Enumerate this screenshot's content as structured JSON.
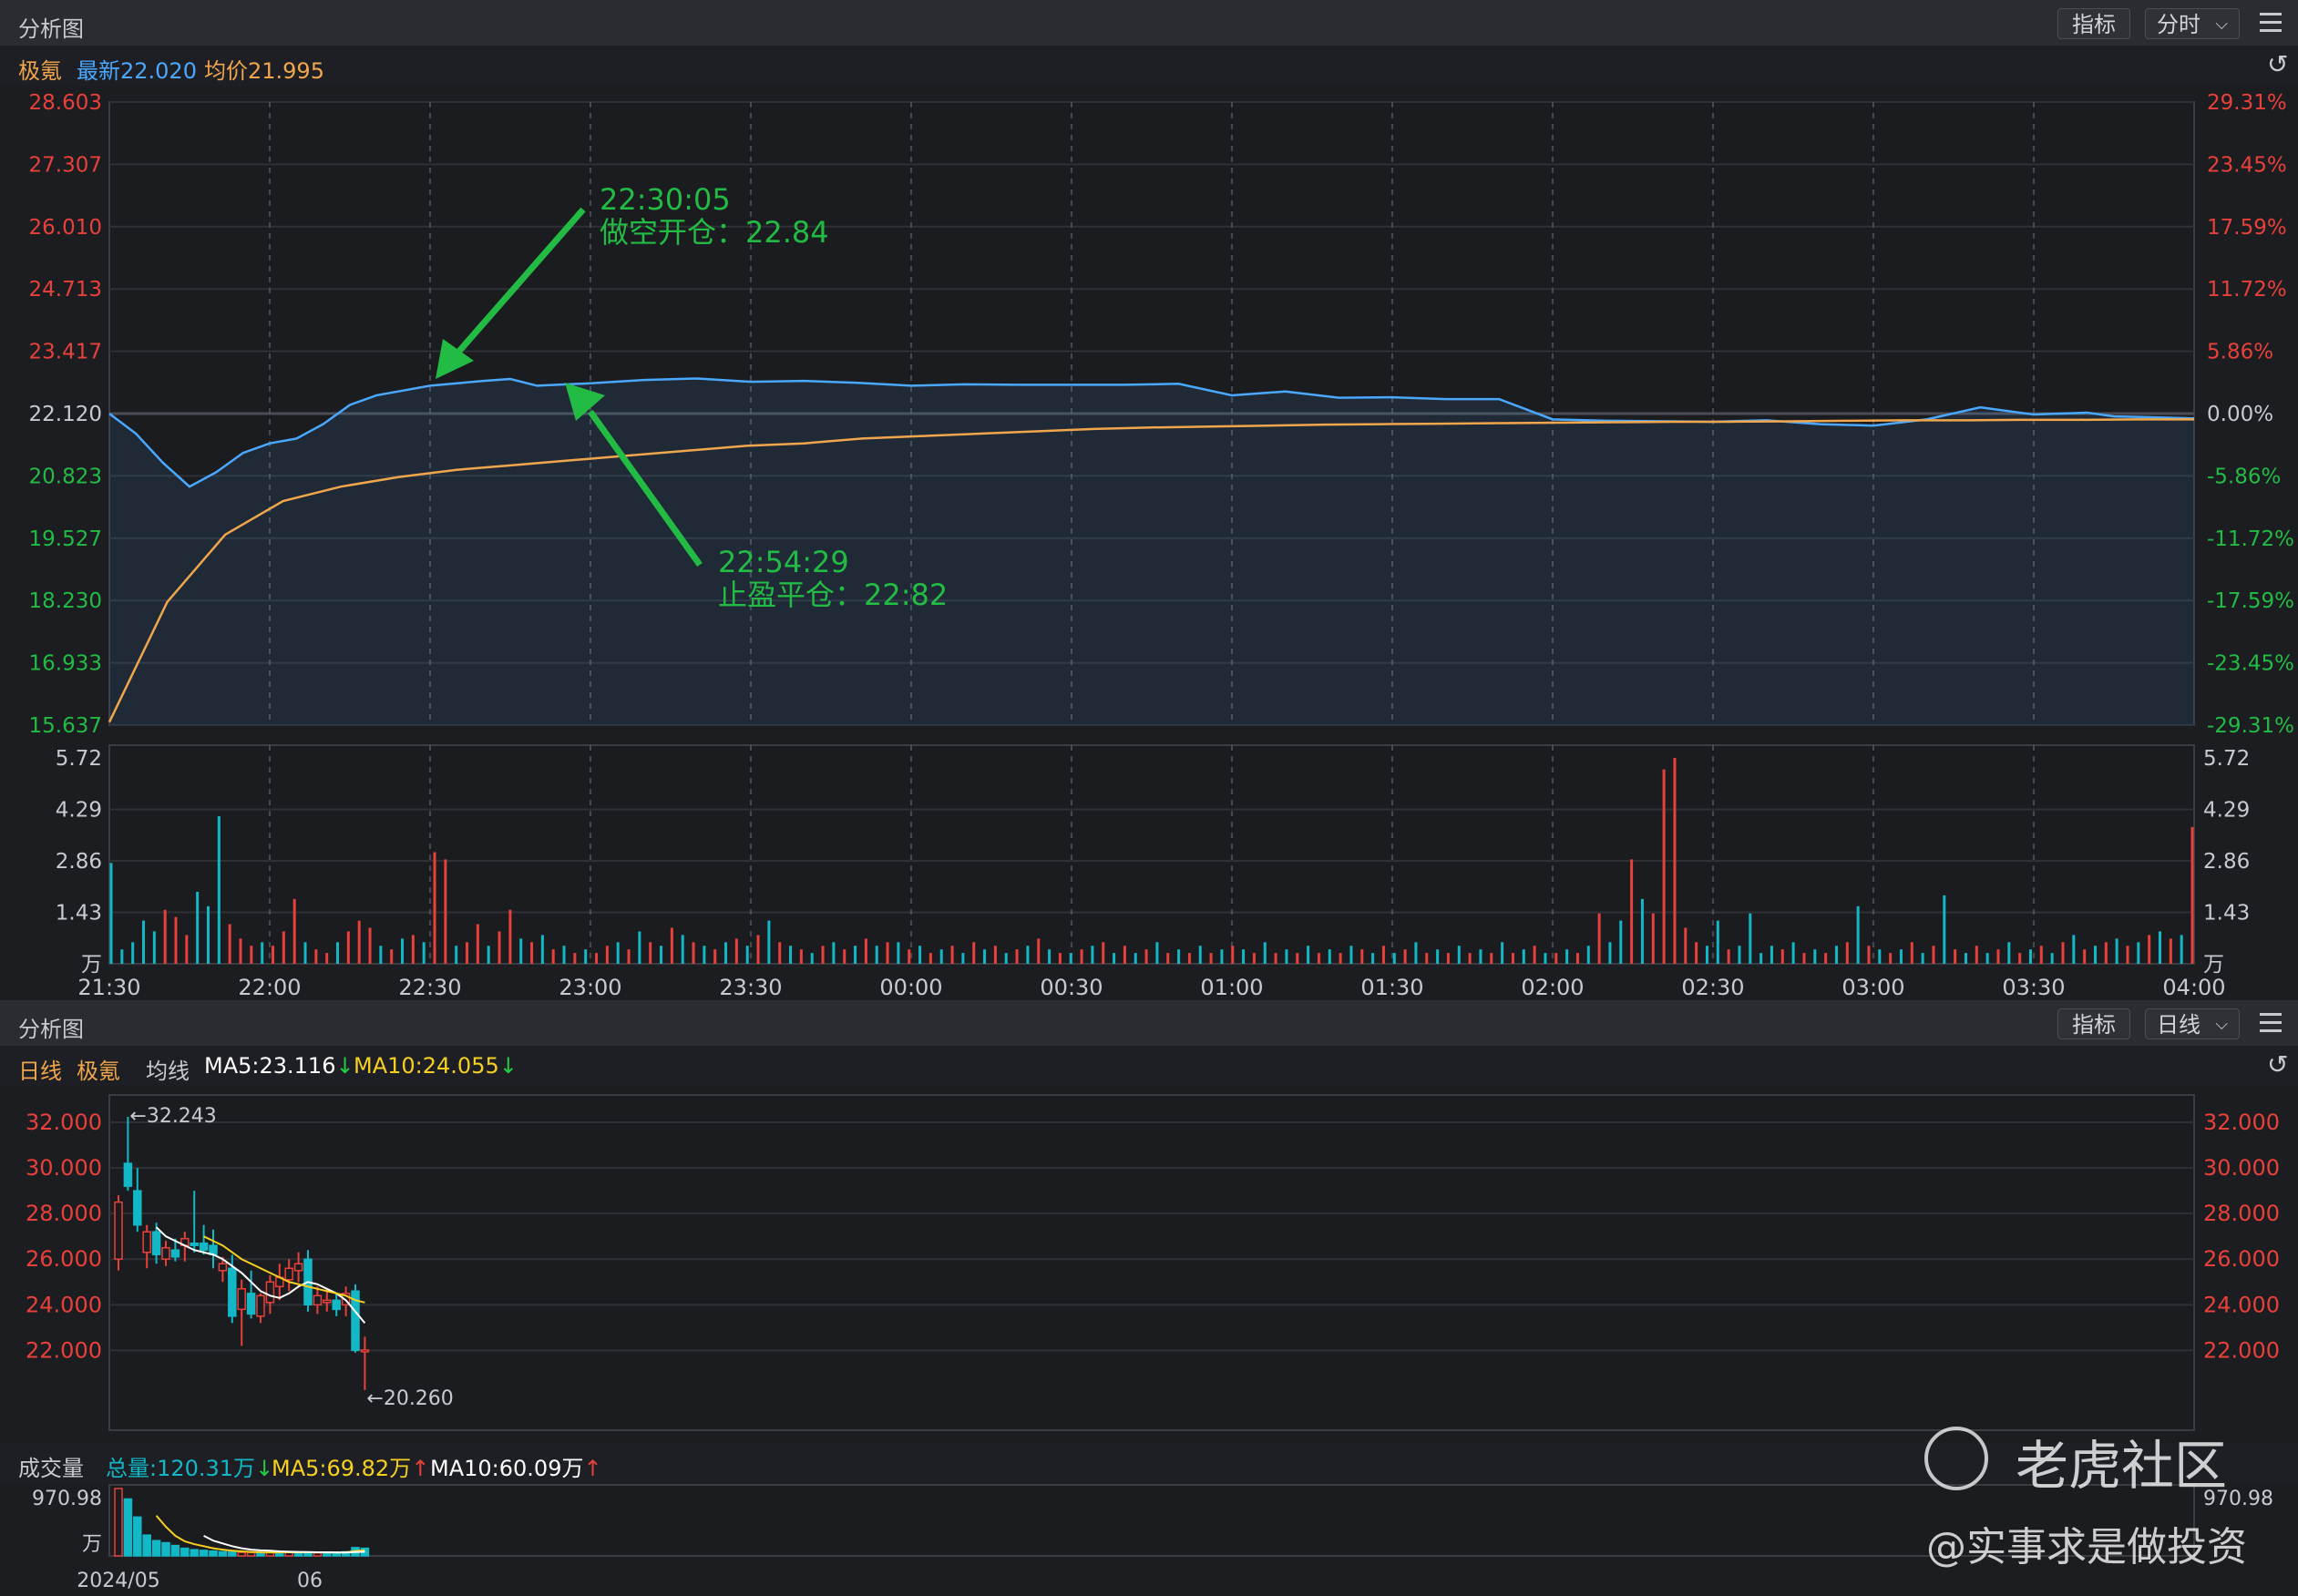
{
  "top_panel": {
    "title": "分析图",
    "indicator_button": "指标",
    "period_button": "分时",
    "symbol": "极氪",
    "latest": "最新22.020",
    "avg": "均价21.995"
  },
  "bottom_panel": {
    "title": "分析图",
    "indicator_button": "指标",
    "period_button": "日线",
    "period_label": "日线",
    "symbol": "极氪",
    "ma_label": "均线",
    "ma5": "MA5:23.116",
    "ma10": "MA10:24.055",
    "volume_label": "成交量",
    "total_volume": "总量:120.31万",
    "vol_ma5": "MA5:69.82万",
    "vol_ma10": "MA10:60.09万"
  },
  "watermark": {
    "brand": "老虎社区",
    "author": "@实事求是做投资"
  },
  "colors": {
    "price_line": "#4aa8ff",
    "avg_line": "#f0a64c",
    "up": "#e8403a",
    "down": "#12b8c6",
    "annotation": "#22bb44",
    "ma5": "#ffffff",
    "ma10": "#f5d020"
  },
  "chart_data": [
    {
      "type": "line",
      "y_left_ticks": [
        "28.603",
        "27.307",
        "26.010",
        "24.713",
        "23.417",
        "22.120",
        "20.823",
        "19.527",
        "18.230",
        "16.933",
        "15.637"
      ],
      "y_right_ticks": [
        "29.31%",
        "23.45%",
        "17.59%",
        "11.72%",
        "5.86%",
        "0.00%",
        "-5.86%",
        "-11.72%",
        "-17.59%",
        "-23.45%",
        "-29.31%"
      ],
      "ylim": [
        15.637,
        28.603
      ],
      "x_ticks": [
        "21:30",
        "22:00",
        "22:30",
        "23:00",
        "23:30",
        "00:00",
        "00:30",
        "01:00",
        "01:30",
        "02:00",
        "02:30",
        "03:00",
        "03:30",
        "04:00"
      ],
      "series": [
        {
          "x": [
            0,
            5,
            10,
            15,
            20,
            25,
            30,
            35,
            40,
            45,
            50,
            55,
            60,
            70,
            75,
            80,
            90,
            100,
            110,
            120,
            130,
            140,
            150,
            160,
            170,
            180,
            190,
            200,
            210,
            220,
            230,
            240,
            250,
            260,
            270,
            280,
            300,
            310,
            320,
            330,
            340,
            350,
            360,
            370,
            375,
            380,
            390
          ],
          "values": [
            22.12,
            21.7,
            21.1,
            20.6,
            20.9,
            21.3,
            21.5,
            21.6,
            21.9,
            22.3,
            22.5,
            22.6,
            22.7,
            22.8,
            22.84,
            22.7,
            22.75,
            22.82,
            22.85,
            22.78,
            22.8,
            22.76,
            22.7,
            22.73,
            22.72,
            22.72,
            22.72,
            22.74,
            22.5,
            22.58,
            22.45,
            22.46,
            22.42,
            22.42,
            22.0,
            21.97,
            21.95,
            21.98,
            21.9,
            21.87,
            22.0,
            22.25,
            22.1,
            22.14,
            22.06,
            22.05,
            22.02
          ]
        },
        {
          "values": [
            15.7,
            18.2,
            19.6,
            20.3,
            20.6,
            20.8,
            20.95,
            21.05,
            21.15,
            21.25,
            21.35,
            21.45,
            21.5,
            21.6,
            21.65,
            21.7,
            21.75,
            21.8,
            21.83,
            21.85,
            21.87,
            21.89,
            21.9,
            21.91,
            21.92,
            21.93,
            21.94,
            21.95,
            21.95,
            21.96,
            21.97,
            21.98,
            21.98,
            21.99,
            21.99,
            22.0,
            22.0
          ]
        }
      ],
      "annotations": [
        {
          "time": "22:30:05",
          "text": "做空开仓：22.84"
        },
        {
          "time": "22:54:29",
          "text": "止盈平仓：22:82"
        }
      ]
    },
    {
      "type": "bar",
      "y_ticks": [
        "5.72",
        "4.29",
        "2.86",
        "1.43",
        "万"
      ],
      "ylim": [
        0,
        5.72
      ],
      "x_ticks": [
        "21:30",
        "22:00",
        "22:30",
        "23:00",
        "23:30",
        "00:00",
        "00:30",
        "01:00",
        "01:30",
        "02:00",
        "02:30",
        "03:00",
        "03:30",
        "04:00"
      ],
      "values": [
        2.8,
        0.4,
        0.6,
        1.2,
        0.9,
        1.5,
        1.3,
        0.8,
        2.0,
        1.6,
        4.1,
        1.1,
        0.7,
        0.5,
        0.6,
        0.5,
        0.9,
        1.8,
        0.6,
        0.4,
        0.3,
        0.6,
        0.9,
        1.2,
        1.0,
        0.5,
        0.4,
        0.7,
        0.8,
        0.6,
        3.1,
        2.9,
        0.5,
        0.6,
        1.1,
        0.5,
        0.9,
        1.5,
        0.7,
        0.6,
        0.8,
        0.4,
        0.5,
        0.3,
        0.4,
        0.3,
        0.5,
        0.6,
        0.4,
        0.9,
        0.6,
        0.5,
        1.0,
        0.8,
        0.6,
        0.5,
        0.4,
        0.6,
        0.7,
        0.5,
        0.8,
        1.2,
        0.6,
        0.5,
        0.4,
        0.3,
        0.5,
        0.6,
        0.4,
        0.5,
        0.7,
        0.5,
        0.6,
        0.6,
        0.4,
        0.5,
        0.3,
        0.4,
        0.5,
        0.3,
        0.6,
        0.4,
        0.5,
        0.3,
        0.4,
        0.5,
        0.7,
        0.4,
        0.3,
        0.3,
        0.4,
        0.5,
        0.6,
        0.3,
        0.5,
        0.3,
        0.4,
        0.6,
        0.3,
        0.4,
        0.3,
        0.5,
        0.3,
        0.4,
        0.5,
        0.4,
        0.3,
        0.6,
        0.3,
        0.4,
        0.3,
        0.5,
        0.3,
        0.4,
        0.3,
        0.5,
        0.4,
        0.3,
        0.5,
        0.3,
        0.4,
        0.6,
        0.3,
        0.4,
        0.3,
        0.5,
        0.3,
        0.4,
        0.3,
        0.6,
        0.3,
        0.4,
        0.5,
        0.3,
        0.3,
        0.4,
        0.3,
        0.5,
        1.4,
        0.6,
        1.2,
        2.9,
        1.8,
        1.4,
        5.4,
        5.72,
        1.0,
        0.6,
        0.5,
        1.2,
        0.4,
        0.5,
        1.4,
        0.3,
        0.5,
        0.4,
        0.6,
        0.3,
        0.4,
        0.3,
        0.5,
        0.6,
        1.6,
        0.5,
        0.4,
        0.3,
        0.4,
        0.6,
        0.3,
        0.5,
        1.9,
        0.4,
        0.3,
        0.5,
        0.3,
        0.4,
        0.6,
        0.3,
        0.4,
        0.5,
        0.3,
        0.6,
        0.8,
        0.4,
        0.5,
        0.6,
        0.7,
        0.5,
        0.6,
        0.8,
        0.9,
        0.7,
        0.8,
        3.8
      ],
      "up": [
        false,
        false,
        false,
        false,
        false,
        true,
        true,
        true,
        false,
        false,
        false,
        true,
        true,
        true,
        false,
        true,
        true,
        true,
        false,
        true,
        true,
        false,
        true,
        true,
        true,
        false,
        true,
        false,
        true,
        false,
        true,
        true,
        false,
        true,
        true,
        false,
        true,
        true,
        false,
        true,
        false,
        true,
        false,
        true,
        false,
        true,
        true,
        false,
        true,
        false,
        true,
        false,
        true,
        false,
        true,
        false,
        true,
        false,
        true,
        false,
        true,
        false,
        true,
        false,
        true,
        false,
        true,
        false,
        true,
        false,
        true,
        false,
        true,
        false,
        true,
        false,
        true,
        false,
        true,
        false,
        true,
        false,
        true,
        false,
        true,
        false,
        true,
        false,
        true,
        false,
        true,
        false,
        true,
        false,
        true,
        false,
        true,
        false,
        true,
        false,
        true,
        false,
        true,
        false,
        true,
        false,
        true,
        false,
        true,
        false,
        true,
        false,
        true,
        false,
        true,
        false,
        true,
        false,
        true,
        false,
        true,
        false,
        true,
        false,
        true,
        false,
        true,
        false,
        true,
        false,
        true,
        false,
        true,
        false,
        true,
        false,
        true,
        false,
        true,
        false,
        false,
        true,
        false,
        true,
        true,
        true,
        true,
        true,
        false,
        false,
        true,
        false,
        false,
        false,
        false,
        true,
        false,
        true,
        false,
        true,
        false,
        true,
        false,
        true,
        false,
        true,
        false,
        true,
        false,
        true,
        false,
        true,
        false,
        true,
        false,
        true,
        false,
        true,
        false,
        true,
        false,
        true,
        false,
        true,
        false,
        true,
        false,
        true,
        false,
        true,
        false,
        true,
        false,
        true,
        false,
        true,
        false,
        false
      ]
    },
    {
      "type": "candlestick",
      "y_ticks": [
        "32.000",
        "30.000",
        "28.000",
        "26.000",
        "24.000",
        "22.000"
      ],
      "ylim": [
        18.5,
        33.2
      ],
      "high_label": "←32.243",
      "low_label": "←20.260",
      "candles": [
        {
          "o": 26.0,
          "h": 28.8,
          "l": 25.5,
          "c": 28.5
        },
        {
          "o": 30.2,
          "h": 32.243,
          "l": 29.0,
          "c": 29.2
        },
        {
          "o": 29.0,
          "h": 30.0,
          "l": 27.2,
          "c": 27.5
        },
        {
          "o": 26.3,
          "h": 27.5,
          "l": 25.6,
          "c": 27.2
        },
        {
          "o": 27.2,
          "h": 27.6,
          "l": 25.8,
          "c": 26.2
        },
        {
          "o": 26.0,
          "h": 26.8,
          "l": 25.7,
          "c": 26.5
        },
        {
          "o": 26.4,
          "h": 26.9,
          "l": 25.9,
          "c": 26.1
        },
        {
          "o": 26.6,
          "h": 27.2,
          "l": 25.9,
          "c": 26.9
        },
        {
          "o": 26.7,
          "h": 29.0,
          "l": 26.3,
          "c": 26.6
        },
        {
          "o": 26.7,
          "h": 27.5,
          "l": 26.2,
          "c": 26.4
        },
        {
          "o": 26.6,
          "h": 27.3,
          "l": 25.6,
          "c": 26.2
        },
        {
          "o": 25.5,
          "h": 26.1,
          "l": 25.0,
          "c": 25.8
        },
        {
          "o": 25.6,
          "h": 26.2,
          "l": 23.2,
          "c": 23.5
        },
        {
          "o": 23.8,
          "h": 25.1,
          "l": 22.2,
          "c": 24.7
        },
        {
          "o": 24.5,
          "h": 25.5,
          "l": 23.4,
          "c": 23.6
        },
        {
          "o": 23.5,
          "h": 24.5,
          "l": 23.2,
          "c": 24.4
        },
        {
          "o": 24.1,
          "h": 25.3,
          "l": 23.6,
          "c": 25.0
        },
        {
          "o": 24.8,
          "h": 25.8,
          "l": 24.2,
          "c": 25.2
        },
        {
          "o": 25.1,
          "h": 26.0,
          "l": 24.6,
          "c": 25.6
        },
        {
          "o": 25.5,
          "h": 26.3,
          "l": 25.0,
          "c": 25.8
        },
        {
          "o": 26.0,
          "h": 26.4,
          "l": 23.7,
          "c": 24.0
        },
        {
          "o": 24.0,
          "h": 24.8,
          "l": 23.6,
          "c": 24.4
        },
        {
          "o": 24.1,
          "h": 24.7,
          "l": 23.7,
          "c": 24.2
        },
        {
          "o": 24.2,
          "h": 24.5,
          "l": 23.5,
          "c": 23.8
        },
        {
          "o": 24.0,
          "h": 24.8,
          "l": 23.5,
          "c": 24.5
        },
        {
          "o": 24.6,
          "h": 24.9,
          "l": 21.9,
          "c": 22.0
        },
        {
          "o": 22.0,
          "h": 22.6,
          "l": 20.26,
          "c": 22.02
        }
      ],
      "ma5": [
        null,
        null,
        null,
        null,
        27.4,
        27.0,
        26.8,
        26.6,
        26.4,
        26.3,
        26.2,
        26.0,
        25.7,
        25.4,
        25.0,
        24.6,
        24.4,
        24.3,
        24.5,
        24.8,
        25.0,
        24.9,
        24.7,
        24.5,
        24.2,
        23.7,
        23.2
      ],
      "ma10": [
        null,
        null,
        null,
        null,
        null,
        null,
        null,
        null,
        null,
        27.0,
        26.8,
        26.6,
        26.3,
        26.0,
        25.8,
        25.6,
        25.4,
        25.2,
        25.0,
        24.9,
        24.8,
        24.7,
        24.6,
        24.5,
        24.4,
        24.2,
        24.1
      ]
    },
    {
      "type": "bar",
      "y_ticks": [
        "970.98",
        "万"
      ],
      "x_ticks": [
        "2024/05",
        "06"
      ],
      "ylim": [
        0,
        970.98
      ],
      "values": [
        970.98,
        820,
        560,
        300,
        220,
        190,
        150,
        110,
        90,
        80,
        70,
        60,
        55,
        50,
        48,
        45,
        60,
        55,
        50,
        52,
        48,
        45,
        50,
        45,
        60,
        120,
        110
      ],
      "up": [
        true,
        false,
        false,
        false,
        false,
        false,
        false,
        false,
        false,
        false,
        false,
        false,
        false,
        true,
        true,
        false,
        true,
        false,
        true,
        false,
        false,
        true,
        false,
        false,
        false,
        false,
        false
      ],
      "ma5": [
        null,
        null,
        null,
        null,
        580,
        420,
        290,
        210,
        170,
        140,
        110,
        90,
        75,
        65,
        58,
        52,
        50,
        52,
        53,
        53,
        52,
        51,
        51,
        50,
        51,
        70,
        80
      ],
      "ma10": [
        null,
        null,
        null,
        null,
        null,
        null,
        null,
        null,
        null,
        290,
        220,
        180,
        140,
        110,
        90,
        80,
        75,
        65,
        60,
        58,
        55,
        53,
        52,
        51,
        50,
        55,
        60
      ]
    }
  ]
}
